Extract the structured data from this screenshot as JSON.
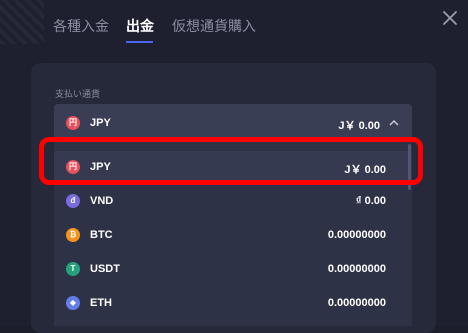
{
  "tabs": [
    {
      "label": "各種入金"
    },
    {
      "label": "出金"
    },
    {
      "label": "仮想通貨購入"
    }
  ],
  "field_label": "支払い通貨",
  "selected": {
    "icon": "円",
    "code": "JPY",
    "amount": "J￥ 0.00"
  },
  "options": [
    {
      "icon": "円",
      "code": "JPY",
      "amount": "J￥ 0.00",
      "icon_name": "yen-coin-icon",
      "icon_color": "#e8505b"
    },
    {
      "icon": "đ",
      "code": "VND",
      "amount": "₫ 0.00",
      "icon_name": "dong-coin-icon",
      "icon_color": "#7a6be0"
    },
    {
      "icon": "₿",
      "code": "BTC",
      "amount": "0.00000000",
      "icon_name": "bitcoin-icon",
      "icon_color": "#f7931a"
    },
    {
      "icon": "T",
      "code": "USDT",
      "amount": "0.00000000",
      "icon_name": "tether-icon",
      "icon_color": "#26a17b"
    },
    {
      "icon": "◆",
      "code": "ETH",
      "amount": "0.00000000",
      "icon_name": "ethereum-icon",
      "icon_color": "#627eea"
    }
  ],
  "colors": {
    "accent": "#4b64f0",
    "highlight": "#ff0000"
  }
}
